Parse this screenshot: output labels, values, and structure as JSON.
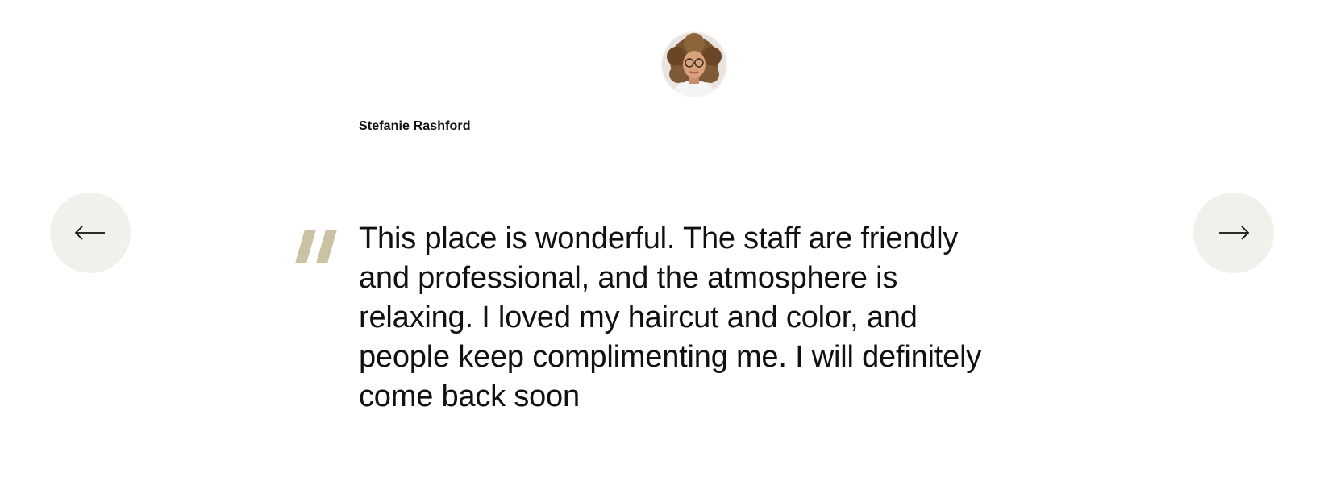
{
  "testimonial": {
    "author_name": "Stefanie Rashford",
    "quote": "This place is wonderful. The staff are friendly and professional, and the atmosphere is relaxing. I loved my haircut and color, and people keep complimenting me. I will definitely come back soon"
  },
  "icons": {
    "prev": "arrow-left-icon",
    "next": "arrow-right-icon",
    "quote": "quote-mark-icon",
    "avatar": "avatar-photo"
  },
  "colors": {
    "nav_button_bg": "#f1f1ec",
    "quote_mark": "#cbc2a3",
    "text": "#111111",
    "background": "#ffffff"
  }
}
